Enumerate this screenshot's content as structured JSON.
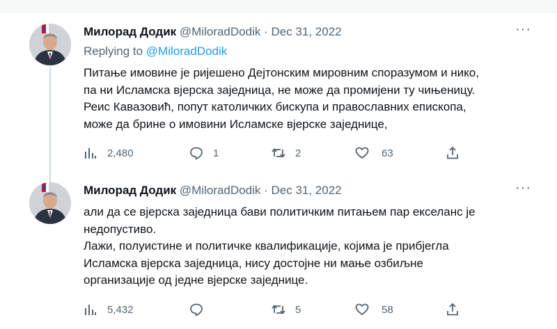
{
  "tweets": [
    {
      "author_name": "Милорад Додик",
      "author_handle": "@MiloradDodik",
      "separator": "·",
      "date": "Dec 31, 2022",
      "more": "···",
      "replying_label": "Replying to",
      "replying_handle": "@MiloradDodik",
      "lines": [
        "Питање имовине је ријешено Дејтонским мировним споразумом и нико,",
        "па ни Исламска вјерска заједница, не може да промијени ту чињеницу.",
        "Реис Кавазовић, попут католичких бискупа и православних епископа,",
        "може да брине о имовини Исламске вјерске заједнице,"
      ],
      "views": "2,480",
      "replies": "1",
      "retweets": "2",
      "likes": "63"
    },
    {
      "author_name": "Милорад Додик",
      "author_handle": "@MiloradDodik",
      "separator": "·",
      "date": "Dec 31, 2022",
      "more": "···",
      "lines": [
        "али да се вјерска заједница бави политичким питањем пар екселанс је",
        "недопустиво.",
        "Лажи, полуистине и политичке квалификације, којима је прибјегла",
        "Исламска вјерска заједница, нису достојне ни мање озбиљне",
        "организације од једне вјерске заједнице."
      ],
      "views": "5,432",
      "replies": "",
      "retweets": "5",
      "likes": "58"
    }
  ],
  "colors": {
    "text": "#0f1419",
    "secondary": "#536471",
    "link": "#1d9bf0",
    "thread_line": "#cfd9de"
  }
}
